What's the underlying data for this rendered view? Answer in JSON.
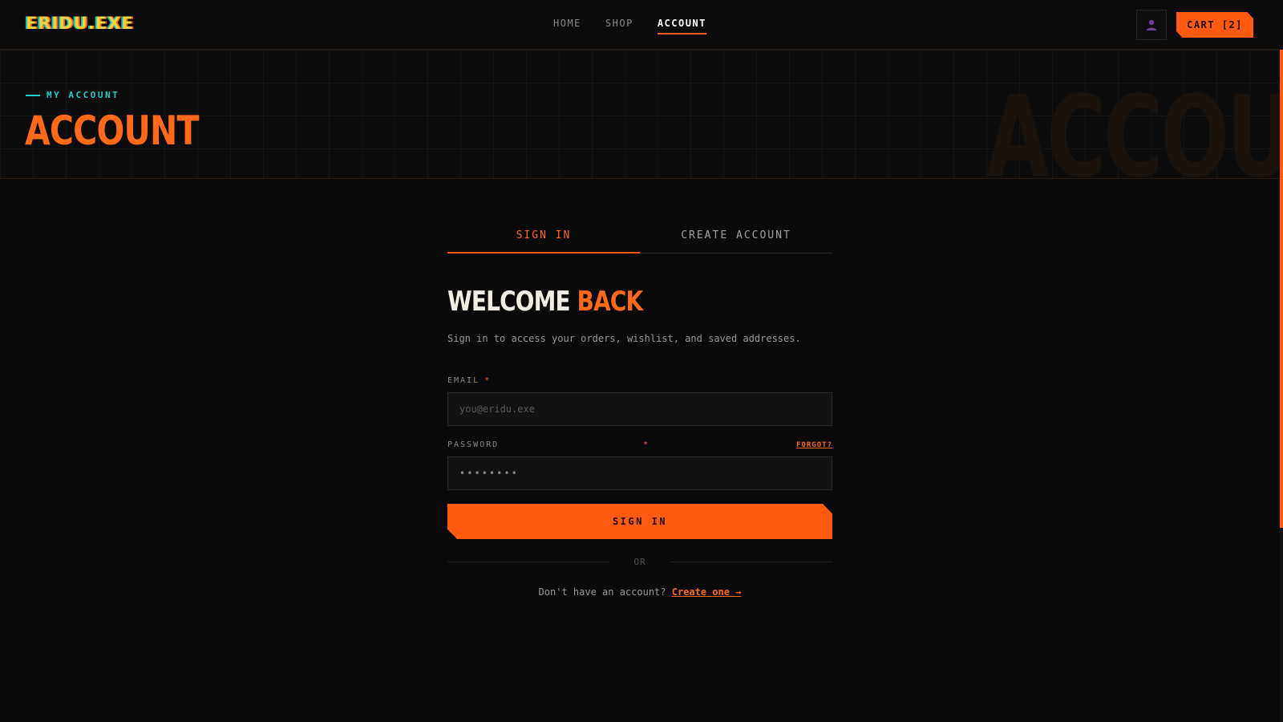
{
  "header": {
    "logo": "ERIDU.EXE",
    "nav": [
      {
        "label": "HOME",
        "active": false
      },
      {
        "label": "SHOP",
        "active": false
      },
      {
        "label": "ACCOUNT",
        "active": true
      }
    ],
    "user_icon": "user-icon",
    "cart_label": "CART [2]"
  },
  "hero": {
    "eyebrow": "MY ACCOUNT",
    "title": "ACCOUNT",
    "ghost_text": "ACCOUNT"
  },
  "auth": {
    "tabs": [
      {
        "label": "SIGN IN",
        "active": true
      },
      {
        "label": "CREATE ACCOUNT",
        "active": false
      }
    ],
    "heading_part1": "WELCOME",
    "heading_part2": "BACK",
    "subtitle": "Sign in to access your orders, wishlist, and saved addresses.",
    "email": {
      "label": "EMAIL",
      "required_mark": "*",
      "placeholder": "you@eridu.exe",
      "value": ""
    },
    "password": {
      "label": "PASSWORD",
      "required_mark": "*",
      "value": "••••••••",
      "forgot_label": "FORGOT?"
    },
    "submit_label": "SIGN IN",
    "divider_label": "OR",
    "signup_prompt": "Don't have an account?",
    "signup_link": "Create one →"
  },
  "colors": {
    "accent": "#ff5a10",
    "secondary_accent": "#1fd1c8",
    "background": "#0a0a0a"
  }
}
